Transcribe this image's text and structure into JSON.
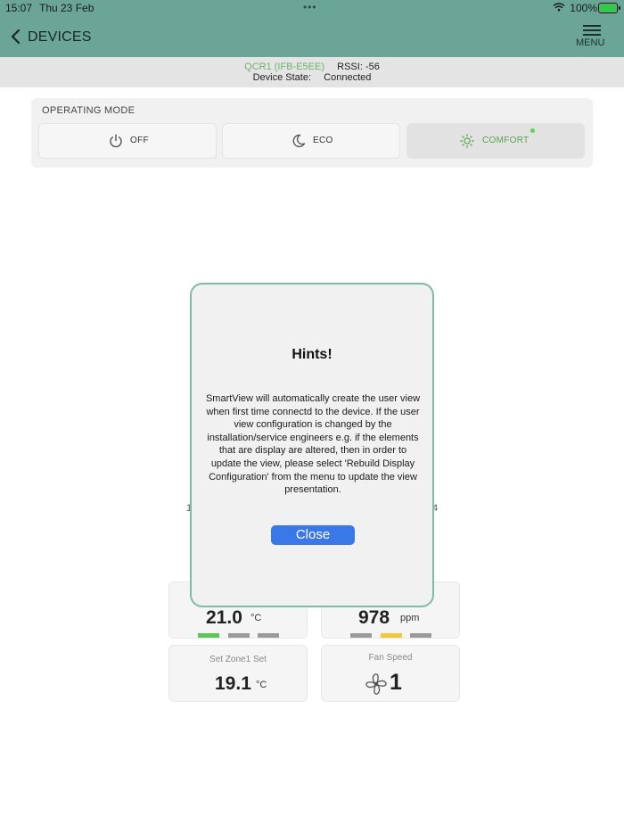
{
  "status_bar": {
    "time": "15:07",
    "date": "Thu 23 Feb",
    "battery": "100%"
  },
  "header": {
    "back_label": "DEVICES",
    "menu_label": "MENU",
    "multitask_dots": "•••"
  },
  "device": {
    "name": "QCR1 (IFB-E5EE)",
    "rssi_label": "RSSI:",
    "rssi_value": "-56",
    "state_label": "Device State:",
    "state_value": "Connected"
  },
  "operating_mode": {
    "title": "OPERATING MODE",
    "options": [
      {
        "label": "OFF",
        "icon": "power-icon",
        "active": false
      },
      {
        "label": "ECO",
        "icon": "moon-icon",
        "active": false
      },
      {
        "label": "COMFORT",
        "icon": "sun-icon",
        "active": true
      }
    ]
  },
  "background_fragments": {
    "left": "1",
    "right": "4"
  },
  "tiles": [
    {
      "value": "21.0",
      "unit": "°C",
      "bar_colors": [
        "#5cc65c",
        "#9a9a9a",
        "#9a9a9a"
      ]
    },
    {
      "value": "978",
      "unit": "ppm",
      "bar_colors": [
        "#9a9a9a",
        "#f0c83c",
        "#9a9a9a"
      ]
    },
    {
      "caption": "Set Zone1 Set",
      "value": "19.1",
      "unit": "°C"
    },
    {
      "caption": "Fan Speed",
      "value": "1",
      "icon": "fan-icon"
    }
  ],
  "modal": {
    "title": "Hints!",
    "body": "SmartView will automatically create the user view when first time connectd to the device. If the user view configuration is changed by the installation/service engineers e.g. if the elements that are display are altered, then in order to update the view, please select 'Rebuild Display Configuration' from the menu to update the view presentation.",
    "close_label": "Close",
    "accent": "#7fbaa9",
    "button_color": "#3a78e8"
  },
  "colors": {
    "header": "#6aa597",
    "active_mode": "#5aa34f"
  }
}
